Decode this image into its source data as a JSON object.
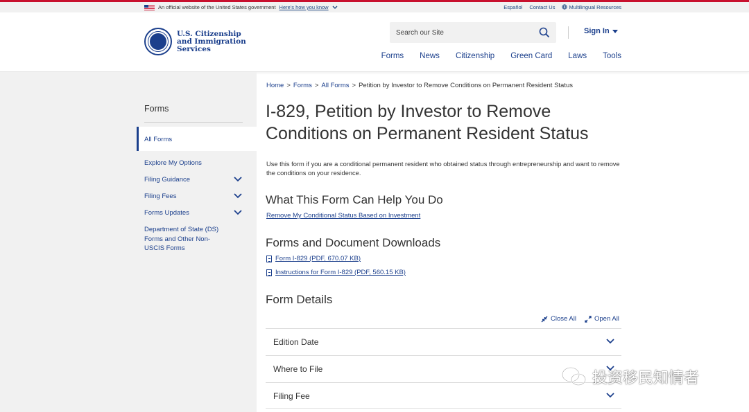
{
  "gov_banner": {
    "official_text": "An official website of the United States government",
    "how_you_know": "Here's how you know",
    "espanol": "Español",
    "contact": "Contact Us",
    "multilingual": "Multilingual Resources"
  },
  "header": {
    "logo_line1": "U.S. Citizenship",
    "logo_line2": "and Immigration",
    "logo_line3": "Services",
    "search_placeholder": "Search our Site",
    "sign_in": "Sign In",
    "nav": [
      "Forms",
      "News",
      "Citizenship",
      "Green Card",
      "Laws",
      "Tools"
    ]
  },
  "sidebar": {
    "title": "Forms",
    "active_item": "All Forms",
    "items": [
      "Explore My Options",
      "Filing Guidance",
      "Filing Fees",
      "Forms Updates",
      "Department of State (DS) Forms and Other Non-USCIS Forms"
    ]
  },
  "breadcrumb": [
    "Home",
    ">",
    "Forms",
    ">",
    "All Forms",
    ">",
    "Petition by Investor to Remove Conditions on Permanent Resident Status"
  ],
  "main": {
    "title": "I-829, Petition by Investor to Remove Conditions on Permanent Resident Status",
    "intro": "Use this form if you are a conditional permanent resident who obtained status through entrepreneurship and want to remove the conditions on your residence.",
    "help_heading": "What This Form Can Help You Do",
    "help_link": "Remove My Conditional Status Based on Investment",
    "downloads_heading": "Forms and Document Downloads",
    "downloads": [
      "Form I-829 (PDF, 670.07 KB)",
      "Instructions for Form I-829 (PDF, 560.15 KB)"
    ],
    "details_heading": "Form Details",
    "close_all": "Close All",
    "open_all": "Open All",
    "accordions": [
      "Edition Date",
      "Where to File",
      "Filing Fee"
    ]
  },
  "watermark": "投资移民知情者",
  "colors": {
    "brand_blue": "#1b3f8c",
    "banner_red": "#c8102e",
    "sidebar_bg": "#f1f1f1"
  }
}
